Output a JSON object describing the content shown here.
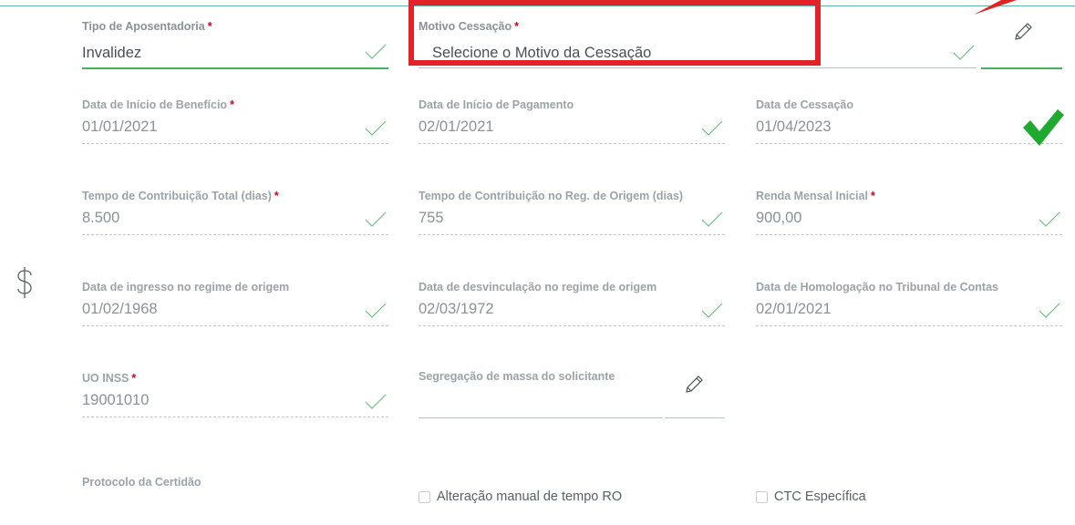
{
  "fields": {
    "tipo_aposentadoria": {
      "label": "Tipo de Aposentadoria",
      "required": "*",
      "value": "Invalidez"
    },
    "motivo_cessacao": {
      "label": "Motivo Cessação",
      "required": "*",
      "placeholder": "Selecione o Motivo da Cessação"
    },
    "data_inicio_beneficio": {
      "label": "Data de Início de Benefício",
      "required": "*",
      "value": "01/01/2021"
    },
    "data_inicio_pagamento": {
      "label": "Data de Início de Pagamento",
      "value": "02/01/2021"
    },
    "data_cessacao": {
      "label": "Data de Cessação",
      "value": "01/04/2023"
    },
    "tempo_contribuicao_total": {
      "label": "Tempo de Contribuição Total (dias)",
      "required": "*",
      "value": "8.500"
    },
    "tempo_contribuicao_origem": {
      "label": "Tempo de Contribuição no Reg. de Origem (dias)",
      "value": "755"
    },
    "renda_mensal_inicial": {
      "label": "Renda Mensal Inicial",
      "required": "*",
      "value": "900,00"
    },
    "data_ingresso_origem": {
      "label": "Data de ingresso no regime de origem",
      "value": "01/02/1968"
    },
    "data_desvinculacao_origem": {
      "label": "Data de desvinculação no regime de origem",
      "value": "02/03/1972"
    },
    "data_homologacao_tc": {
      "label": "Data de Homologação no Tribunal de Contas",
      "value": "02/01/2021"
    },
    "uo_inss": {
      "label": "UO INSS",
      "required": "*",
      "value": "19001010"
    },
    "segregacao_massa": {
      "label": "Segregação de massa do solicitante",
      "value": ""
    },
    "protocolo_certidao": {
      "label": "Protocolo da Certidão",
      "value": ""
    }
  },
  "checkboxes": {
    "alteracao_manual": {
      "label": "Alteração manual de tempo RO",
      "checked": false
    },
    "ctc_especifica": {
      "label": "CTC Específica",
      "checked": false
    }
  },
  "icons": {
    "currency": "dollar-sign-icon",
    "edit": "pencil-icon",
    "valid": "checkmark-icon",
    "annotation_check": "big-green-check-icon",
    "annotation_arrow": "red-arrow-icon"
  },
  "colors": {
    "accent": "#4cae63",
    "highlight": "#e32225",
    "required": "#d0021b",
    "top_line": "#5fb3b0"
  }
}
